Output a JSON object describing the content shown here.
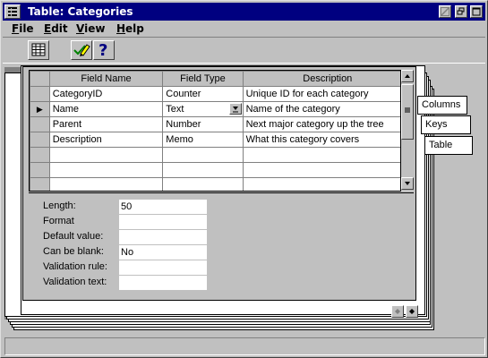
{
  "window": {
    "title": "Table: Categories"
  },
  "menu": [
    {
      "label": "File",
      "accel": "F",
      "rest": "ile"
    },
    {
      "label": "Edit",
      "accel": "E",
      "rest": "dit"
    },
    {
      "label": "View",
      "accel": "V",
      "rest": "iew"
    },
    {
      "label": "Help",
      "accel": "H",
      "rest": "elp"
    }
  ],
  "toolbar": {
    "table_icon": "table-grid-icon",
    "edit_icon": "pencil-check-icon",
    "help_label": "?"
  },
  "grid": {
    "headers": [
      "Field Name",
      "Field Type",
      "Description"
    ],
    "rows": [
      {
        "name": "CategoryID",
        "type": "Counter",
        "desc": "Unique ID for each category",
        "current": false
      },
      {
        "name": "Name",
        "type": "Text",
        "desc": "Name of the category",
        "current": true
      },
      {
        "name": "Parent",
        "type": "Number",
        "desc": "Next major category up the tree",
        "current": false
      },
      {
        "name": "Description",
        "type": "Memo",
        "desc": "What this category covers",
        "current": false
      },
      {
        "name": "",
        "type": "",
        "desc": "",
        "current": false
      },
      {
        "name": "",
        "type": "",
        "desc": "",
        "current": false
      },
      {
        "name": "",
        "type": "",
        "desc": "",
        "current": false
      }
    ],
    "current_marker": "▶"
  },
  "properties": [
    {
      "label": "Length:",
      "value": "50"
    },
    {
      "label": "Format",
      "value": ""
    },
    {
      "label": "Default value:",
      "value": ""
    },
    {
      "label": "Can be blank:",
      "value": "No"
    },
    {
      "label": "Validation rule:",
      "value": ""
    },
    {
      "label": "Validation text:",
      "value": ""
    }
  ],
  "tabs": [
    "Columns",
    "Keys",
    "Table"
  ]
}
